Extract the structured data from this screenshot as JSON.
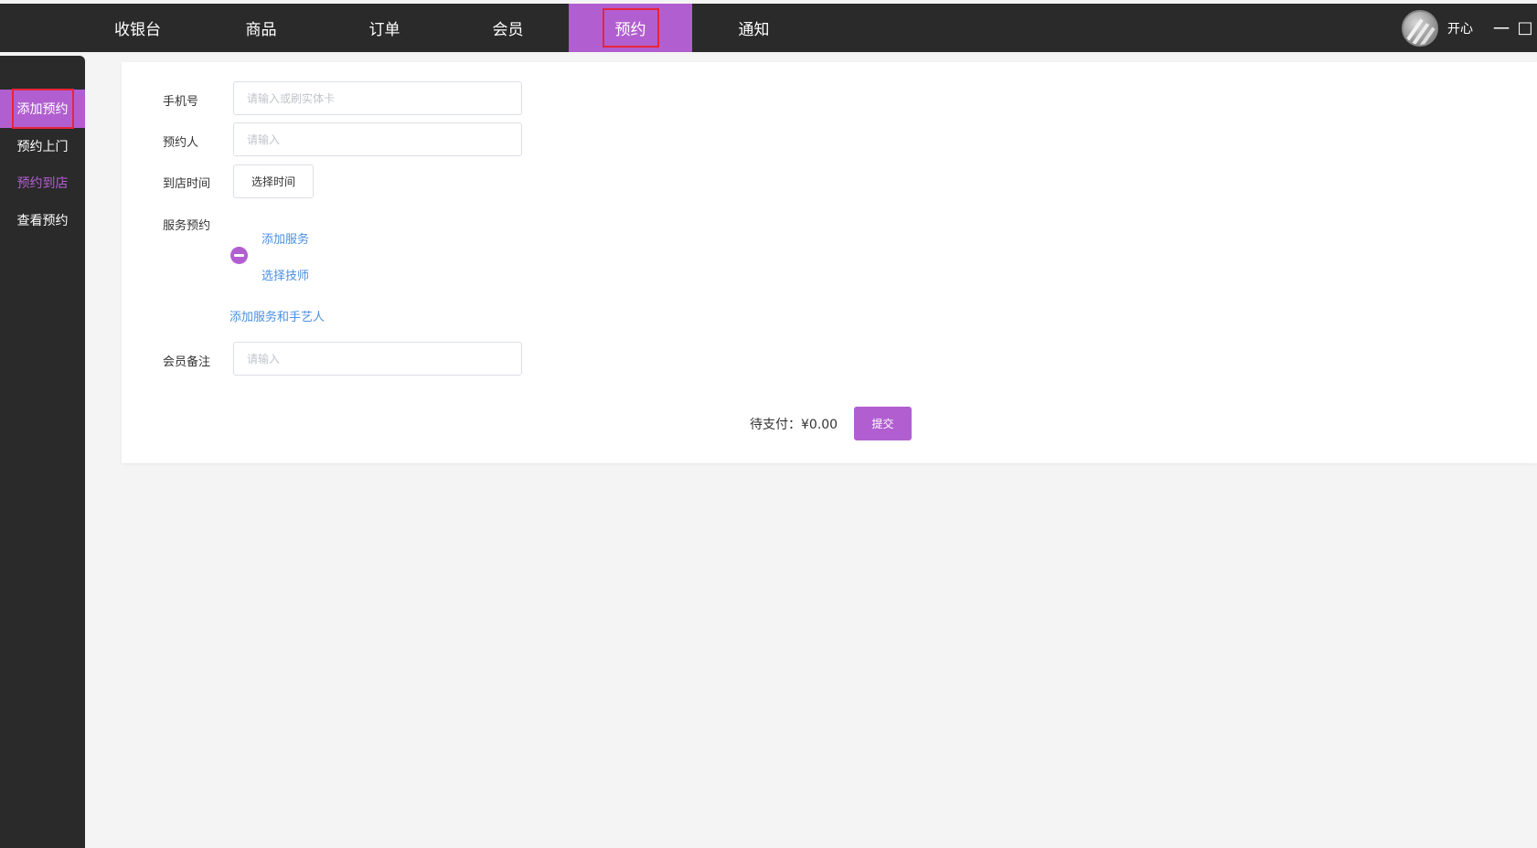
{
  "nav": {
    "items": [
      {
        "label": "收银台"
      },
      {
        "label": "商品"
      },
      {
        "label": "订单"
      },
      {
        "label": "会员"
      },
      {
        "label": "预约"
      },
      {
        "label": "通知"
      }
    ],
    "active_index": 4
  },
  "user": {
    "name": "开心",
    "minimize_symbol": "一",
    "restore_symbol": "□"
  },
  "sidebar": {
    "items": [
      {
        "label": "添加预约"
      },
      {
        "label": "预约上门"
      },
      {
        "label": "预约到店"
      },
      {
        "label": "查看预约"
      }
    ]
  },
  "form": {
    "phone": {
      "label": "手机号",
      "placeholder": "请输入或刷实体卡",
      "value": ""
    },
    "booker": {
      "label": "预约人",
      "placeholder": "请输入",
      "value": ""
    },
    "arrival_time": {
      "label": "到店时间",
      "button": "选择时间"
    },
    "service": {
      "label": "服务预约",
      "add_service": "添加服务",
      "select_technician": "选择技师",
      "add_service_and_artisan": "添加服务和手艺人"
    },
    "member_note": {
      "label": "会员备注",
      "placeholder": "请输入",
      "value": ""
    }
  },
  "footer": {
    "pending_label": "待支付：",
    "pending_amount": "¥0.00",
    "submit": "提交"
  },
  "colors": {
    "accent": "#b15fd0",
    "topbar": "#2a2a2a",
    "highlight_border": "#e8243a",
    "link": "#4a90e2"
  }
}
